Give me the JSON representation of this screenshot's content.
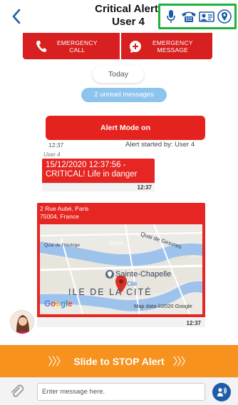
{
  "header": {
    "title_line1": "Critical Alert!",
    "title_line2": "User 4",
    "icons": [
      "microphone-icon",
      "telephone-icon",
      "contact-card-icon",
      "location-pin-icon"
    ],
    "highlight_color": "#1db33a"
  },
  "emergency": {
    "call_label_line1": "EMERGENCY",
    "call_label_line2": "CALL",
    "message_label_line1": "EMERGENCY",
    "message_label_line2": "MESSAGE",
    "color": "#d7201f"
  },
  "chat": {
    "today_label": "Today",
    "unread_label": "2 unread messages",
    "alert_mode_label": "Alert Mode on",
    "alert_time": "12:37",
    "alert_started_by": "Alert started by: User 4",
    "message": {
      "sender": "User 4",
      "text": "15/12/2020 12:37:56 - CRITICAL! Life in danger",
      "time": "12:37"
    },
    "location": {
      "address_line1": "2 Rue Aubé, Paris",
      "address_line2": "75004, France",
      "map_labels": {
        "river_seine": "Seine",
        "quai_gesvres": "Quai de Gesvres",
        "quai_horloge": "Quai de l'Horloge",
        "sainte_chapelle": "Sainte-Chapelle",
        "cite": "Cité",
        "ile": "ILE DE LA CITÉ",
        "google": "Google",
        "map_data": "Map data ©2020 Google"
      },
      "time": "12:37"
    }
  },
  "slide": {
    "label": "Slide to STOP Alert",
    "chevrons": "〉〉〉",
    "color": "#f7921e"
  },
  "input": {
    "placeholder": "Enter message here."
  }
}
